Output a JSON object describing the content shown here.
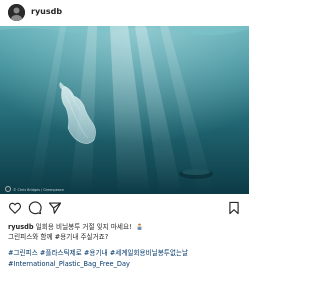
{
  "header": {
    "username": "ryusdb"
  },
  "photo": {
    "credit": "© Chris Bridges / Greenpeace"
  },
  "caption": {
    "username": "ryusdb",
    "line1": "일회용 비닐봉투 거절 잊지 마세요!",
    "emoji_icon": "person-shrugging-icon",
    "line2": "그린피스와 함께 #용기내 주실거죠?",
    "hashtags_line1": "#그린피스 #플라스틱제로 #용기내 #세계일회용비닐봉투없는날",
    "hashtags_line2": "#International_Plastic_Bag_Free_Day"
  },
  "actions": {
    "icons": [
      "heart-icon",
      "comment-icon",
      "share-icon",
      "bookmark-icon"
    ]
  },
  "colors": {
    "hashtag": "#00376b",
    "text": "#262626",
    "water_top": "#4fa3ad",
    "water_bottom": "#0b3b46"
  }
}
